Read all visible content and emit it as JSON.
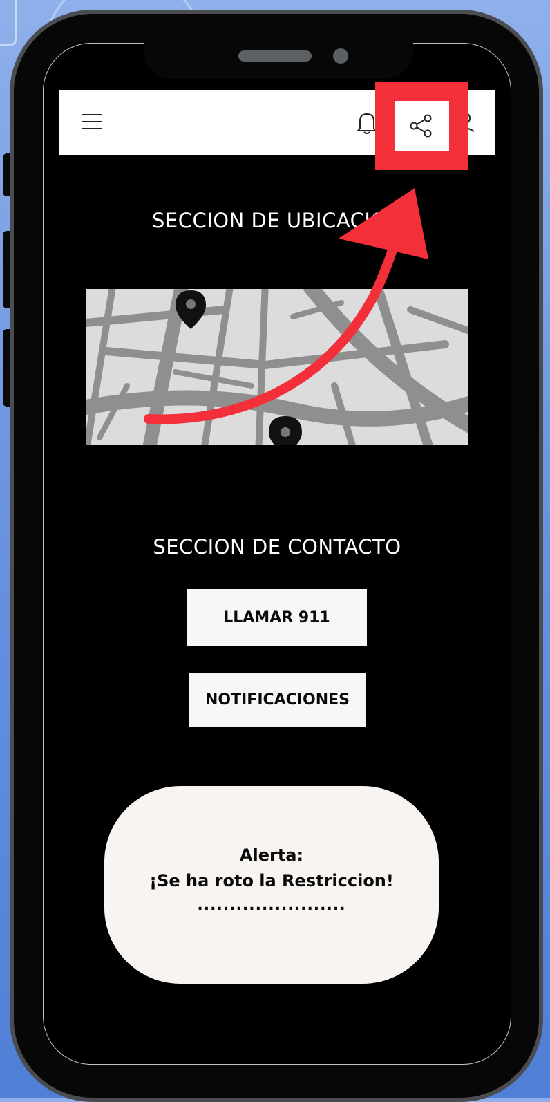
{
  "location_section": {
    "title": "SECCION DE UBICACION"
  },
  "contact_section": {
    "title": "SECCION DE CONTACTO",
    "call_button_label": "LLAMAR 911",
    "notifications_button_label": "NOTIFICACIONES"
  },
  "alert": {
    "title": "Alerta:",
    "message": "¡Se ha roto la Restriccion!",
    "placeholder": "......................."
  },
  "top_bar": {
    "icons": [
      "menu-icon",
      "bell-icon",
      "share-icon",
      "user-icon"
    ],
    "highlighted_icon": "share-icon"
  },
  "colors": {
    "highlight": "#f3303a",
    "screen_bg": "#000000",
    "button_bg": "#f7f7f7",
    "alert_bg": "#f7f4f1"
  }
}
